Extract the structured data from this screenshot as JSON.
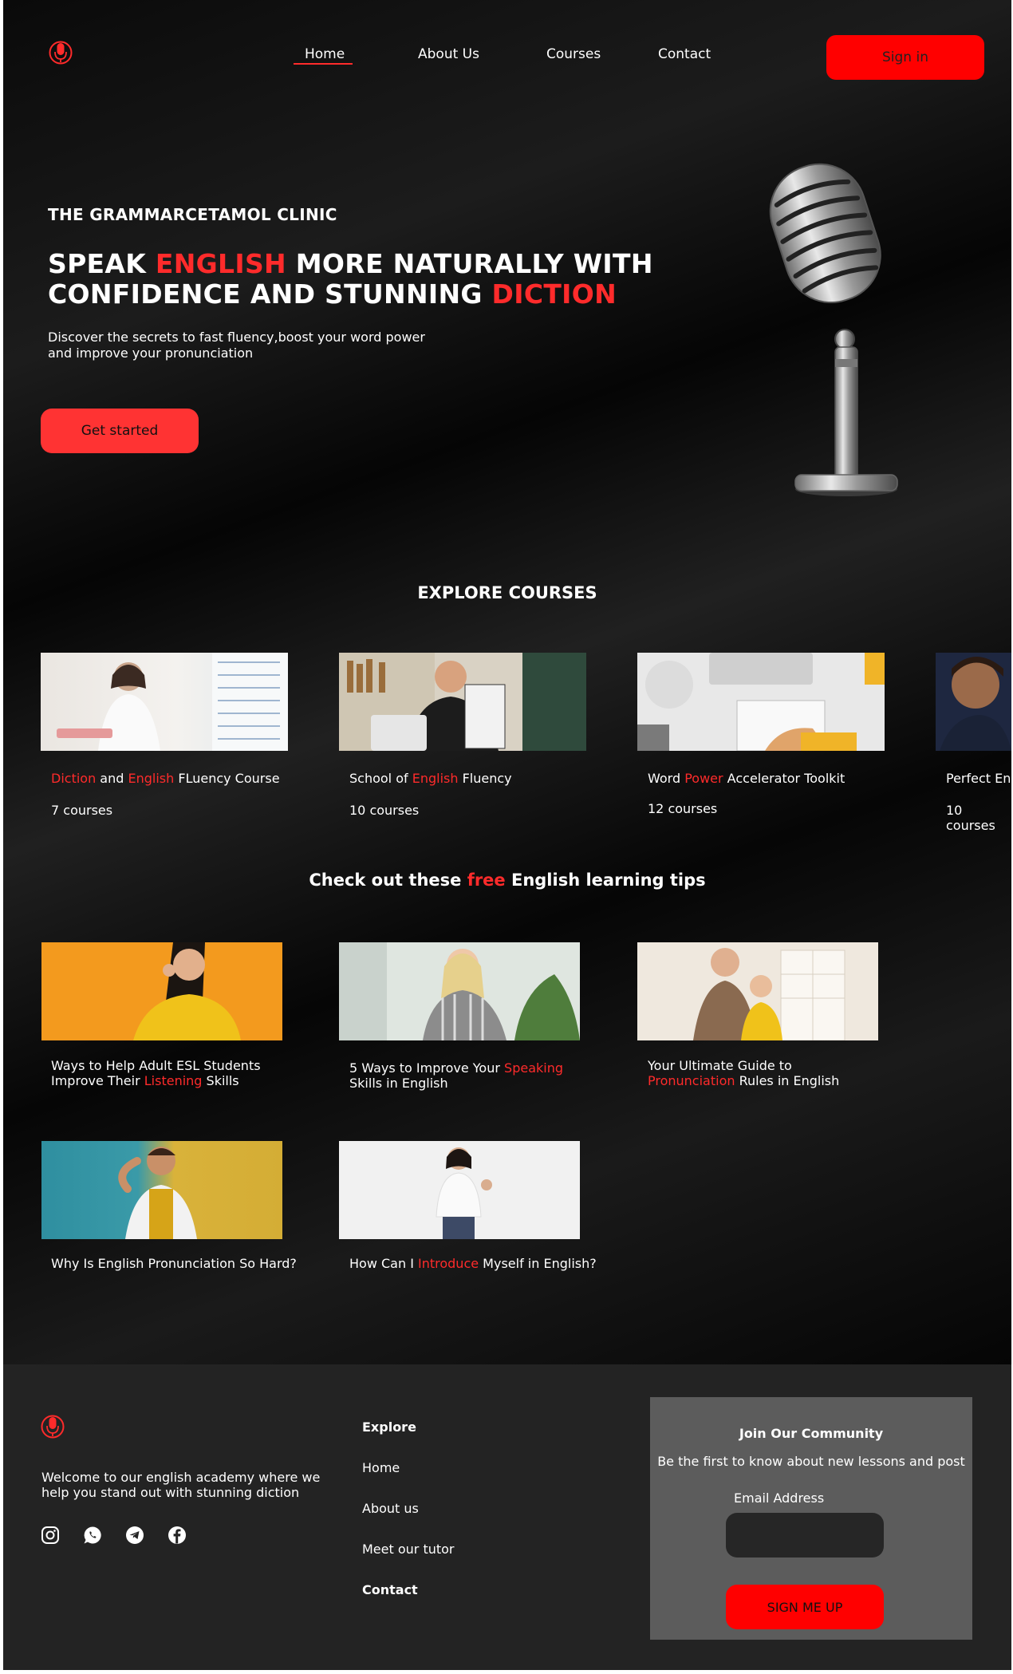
{
  "nav": {
    "items": [
      "Home",
      "About Us",
      "Courses",
      "Contact"
    ],
    "signin": "Sign in"
  },
  "hero": {
    "kicker": "THE GRAMMARCETAMOL CLINIC",
    "title_parts": [
      "SPEAK ",
      "ENGLISH",
      " MORE NATURALLY WITH",
      "CONFIDENCE AND STUNNING ",
      "DICTION"
    ],
    "subtitle_line1": "Discover the secrets to fast fluency,boost your word power",
    "subtitle_line2": "and improve your pronunciation",
    "cta": "Get started"
  },
  "courses": {
    "title": "EXPLORE COURSES",
    "cards": [
      {
        "t1": "Diction",
        "t2": " and ",
        "t3": "English",
        "t4": " FLuency Course",
        "count": "7 courses"
      },
      {
        "t1": "School of ",
        "t2": "English",
        "t3": " Fluency",
        "count": "10 courses"
      },
      {
        "t1": "Word ",
        "t2": "Power",
        "t3": " Accelerator Toolkit",
        "count": "12 courses"
      },
      {
        "t1": "Perfect Eng",
        "count": "10 courses"
      }
    ]
  },
  "tips": {
    "title_a": "Check out these ",
    "title_b": "free",
    "title_c": " English learning tips",
    "items": [
      {
        "l1": "Ways to Help Adult ESL Students",
        "l2a": "Improve Their ",
        "l2b": "Listening",
        "l2c": " Skills"
      },
      {
        "l1a": "5 Ways to Improve Your ",
        "l1b": "Speaking",
        "l2": "Skills in English"
      },
      {
        "l1": "Your Ultimate Guide to",
        "l2a": "Pronunciation",
        "l2b": " Rules in English"
      },
      {
        "l1": "Why Is English Pronunciation So Hard?"
      },
      {
        "l1a": "How Can I ",
        "l1b": "Introduce",
        "l1c": " Myself in English?"
      }
    ]
  },
  "footer": {
    "welcome_l1": "Welcome to our english academy where we",
    "welcome_l2": "help you stand out with stunning diction",
    "social": [
      "instagram-icon",
      "whatsapp-icon",
      "telegram-icon",
      "facebook-icon"
    ],
    "links": [
      "Explore",
      "Home",
      "About us",
      "Meet our tutor",
      "Contact"
    ],
    "newsletter": {
      "title": "Join Our Community",
      "subtitle": "Be the first to know about new lessons and post",
      "email_label": "Email Address",
      "button": "SIGN ME UP"
    }
  },
  "colors": {
    "accent": "#ff2b2b",
    "button_red": "#ff0000",
    "footer_bg": "#232323",
    "newsletter_bg": "#5c5c5c"
  }
}
